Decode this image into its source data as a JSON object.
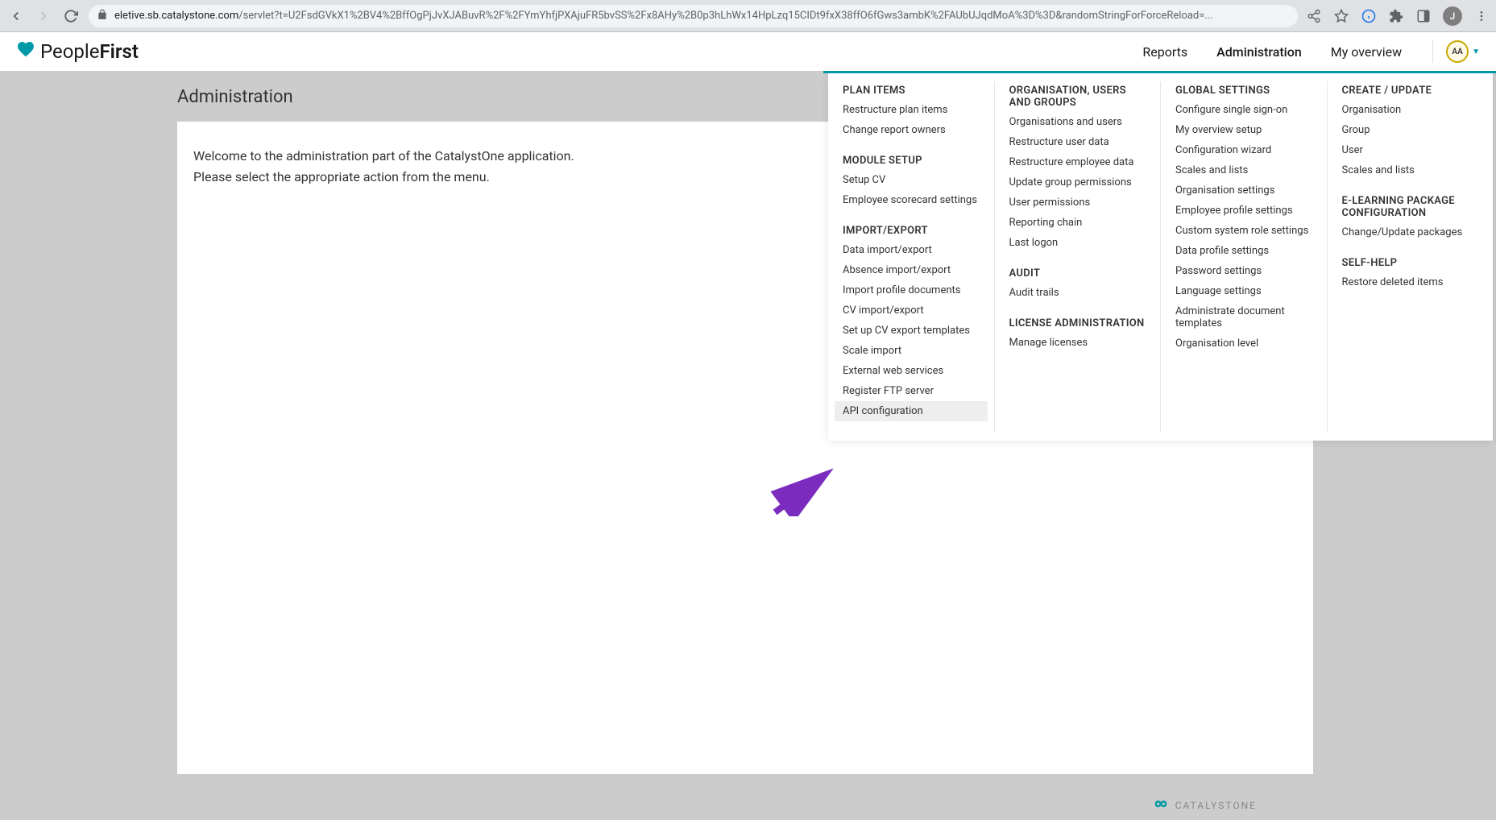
{
  "browser": {
    "url_domain": "eletive.sb.catalystone.com",
    "url_path": "/servlet?t=U2FsdGVkX1%2BV4%2BffOgPjJvXJABuvR%2F%2FYmYhfjPXAjuFR5bvSS%2Fx8AHy%2B0p3hLhWx14HpLzq15CIDt9fxX38ffO6fGws3ambK%2FAUbUJqdMoA%3D%3D&randomStringForForceReload=...",
    "profile_initial": "J"
  },
  "header": {
    "logo_part1": "People",
    "logo_part2": "First",
    "nav": {
      "reports": "Reports",
      "administration": "Administration",
      "my_overview": "My overview"
    },
    "user_badge": "AA"
  },
  "page": {
    "title": "Administration",
    "welcome_line1": "Welcome to the administration part of the CatalystOne application.",
    "welcome_line2": "Please select the appropriate action from the menu."
  },
  "menu": {
    "col1": {
      "plan_items": {
        "heading": "PLAN ITEMS",
        "items": [
          "Restructure plan items",
          "Change report owners"
        ]
      },
      "module_setup": {
        "heading": "MODULE SETUP",
        "items": [
          "Setup CV",
          "Employee scorecard settings"
        ]
      },
      "import_export": {
        "heading": "IMPORT/EXPORT",
        "items": [
          "Data import/export",
          "Absence import/export",
          "Import profile documents",
          "CV import/export",
          "Set up CV export templates",
          "Scale import",
          "External web services",
          "Register FTP server",
          "API configuration"
        ]
      }
    },
    "col2": {
      "org": {
        "heading": "ORGANISATION, USERS AND GROUPS",
        "items": [
          "Organisations and users",
          "Restructure user data",
          "Restructure employee data",
          "Update group permissions",
          "User permissions",
          "Reporting chain",
          "Last logon"
        ]
      },
      "audit": {
        "heading": "AUDIT",
        "items": [
          "Audit trails"
        ]
      },
      "license": {
        "heading": "LICENSE ADMINISTRATION",
        "items": [
          "Manage licenses"
        ]
      }
    },
    "col3": {
      "global": {
        "heading": "GLOBAL SETTINGS",
        "items": [
          "Configure single sign-on",
          "My overview setup",
          "Configuration wizard",
          "Scales and lists",
          "Organisation settings",
          "Employee profile settings",
          "Custom system role settings",
          "Data profile settings",
          "Password settings",
          "Language settings",
          "Administrate document templates",
          "Organisation level"
        ]
      }
    },
    "col4": {
      "create": {
        "heading": "CREATE / UPDATE",
        "items": [
          "Organisation",
          "Group",
          "User",
          "Scales and lists"
        ]
      },
      "elearning": {
        "heading": "E-LEARNING PACKAGE CONFIGURATION",
        "items": [
          "Change/Update packages"
        ]
      },
      "selfhelp": {
        "heading": "SELF-HELP",
        "items": [
          "Restore deleted items"
        ]
      }
    }
  },
  "footer": {
    "brand": "CATALYSTONE"
  }
}
